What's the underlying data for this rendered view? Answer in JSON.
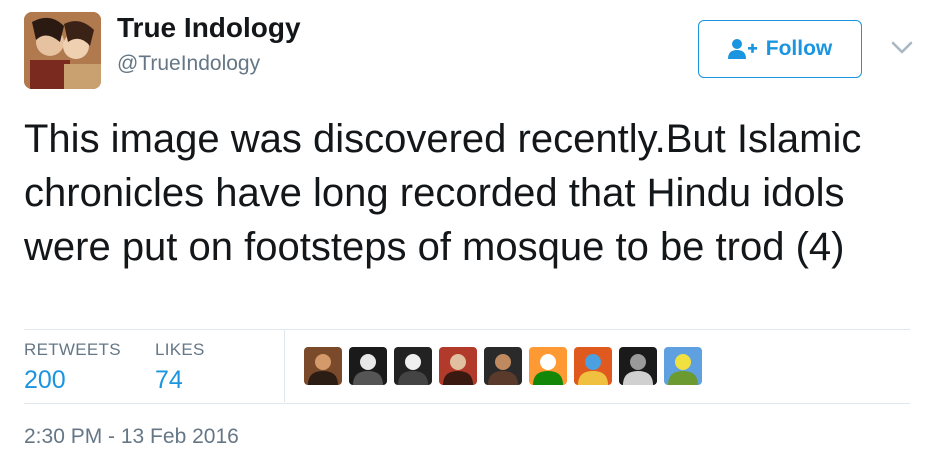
{
  "header": {
    "display_name": "True Indology",
    "handle": "@TrueIndology",
    "follow_label": "Follow"
  },
  "tweet": {
    "text": "This image was discovered recently.But Islamic chronicles have long recorded that Hindu idols were put on footsteps of mosque to be trod (4)"
  },
  "stats": {
    "retweets_label": "RETWEETS",
    "retweets_count": "200",
    "likes_label": "LIKES",
    "likes_count": "74"
  },
  "liker_avatars": [
    {
      "name": "liker-1",
      "colors": [
        "#7a4a2a",
        "#d49a6a",
        "#2b1d14"
      ]
    },
    {
      "name": "liker-2",
      "colors": [
        "#1a1a1a",
        "#e8e8e8",
        "#555555"
      ]
    },
    {
      "name": "liker-3",
      "colors": [
        "#222222",
        "#f0f0f0",
        "#444444"
      ]
    },
    {
      "name": "liker-4",
      "colors": [
        "#b23a2a",
        "#e0c0a0",
        "#3a1a10"
      ]
    },
    {
      "name": "liker-5",
      "colors": [
        "#2a2a2a",
        "#c08a60",
        "#5a3a2a"
      ]
    },
    {
      "name": "liker-6",
      "colors": [
        "#ff9933",
        "#ffffff",
        "#138808"
      ]
    },
    {
      "name": "liker-7",
      "colors": [
        "#e05a20",
        "#4aa0e0",
        "#f0c040"
      ]
    },
    {
      "name": "liker-8",
      "colors": [
        "#1a1a1a",
        "#9a9a9a",
        "#d0d0d0"
      ]
    },
    {
      "name": "liker-9",
      "colors": [
        "#5fa0e0",
        "#f0e040",
        "#6a9a30"
      ]
    }
  ],
  "timestamp": "2:30 PM - 13 Feb 2016",
  "colors": {
    "accent": "#1b95e0",
    "text": "#14171a",
    "secondary": "#657786",
    "divider": "#e1e8ed"
  }
}
